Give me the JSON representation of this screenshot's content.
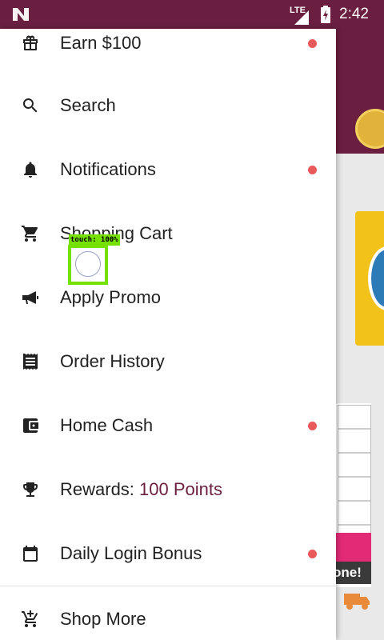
{
  "status_bar": {
    "network": "LTE",
    "time": "2:42"
  },
  "drawer": {
    "items": [
      {
        "id": "earn",
        "label": "Earn $100",
        "icon": "gift-icon",
        "badge_dot": true
      },
      {
        "id": "search",
        "label": "Search",
        "icon": "search-icon",
        "badge_dot": false
      },
      {
        "id": "notifications",
        "label": "Notifications",
        "icon": "bell-icon",
        "badge_dot": true
      },
      {
        "id": "cart",
        "label": "Shopping Cart",
        "icon": "cart-icon",
        "badge_dot": false
      },
      {
        "id": "promo",
        "label": "Apply Promo",
        "icon": "megaphone-icon",
        "badge_dot": false
      },
      {
        "id": "orders",
        "label": "Order History",
        "icon": "receipt-icon",
        "badge_dot": false
      },
      {
        "id": "cash",
        "label": "Home Cash",
        "icon": "wallet-icon",
        "badge_dot": true
      },
      {
        "id": "rewards",
        "label": "Rewards: ",
        "accent": "100 Points",
        "icon": "trophy-icon",
        "badge_dot": false
      },
      {
        "id": "daily",
        "label": "Daily Login Bonus",
        "icon": "calendar-icon",
        "badge_dot": true
      },
      {
        "id": "shop_more",
        "label": "Shop More",
        "icon": "add-cart-icon",
        "badge_dot": false
      }
    ]
  },
  "touch_overlay": {
    "label": "touch: 100%"
  },
  "background_app": {
    "banner_text": "one!"
  },
  "colors": {
    "brand": "#6a1f40",
    "badge": "#e85a5a",
    "touch": "#76e000"
  }
}
